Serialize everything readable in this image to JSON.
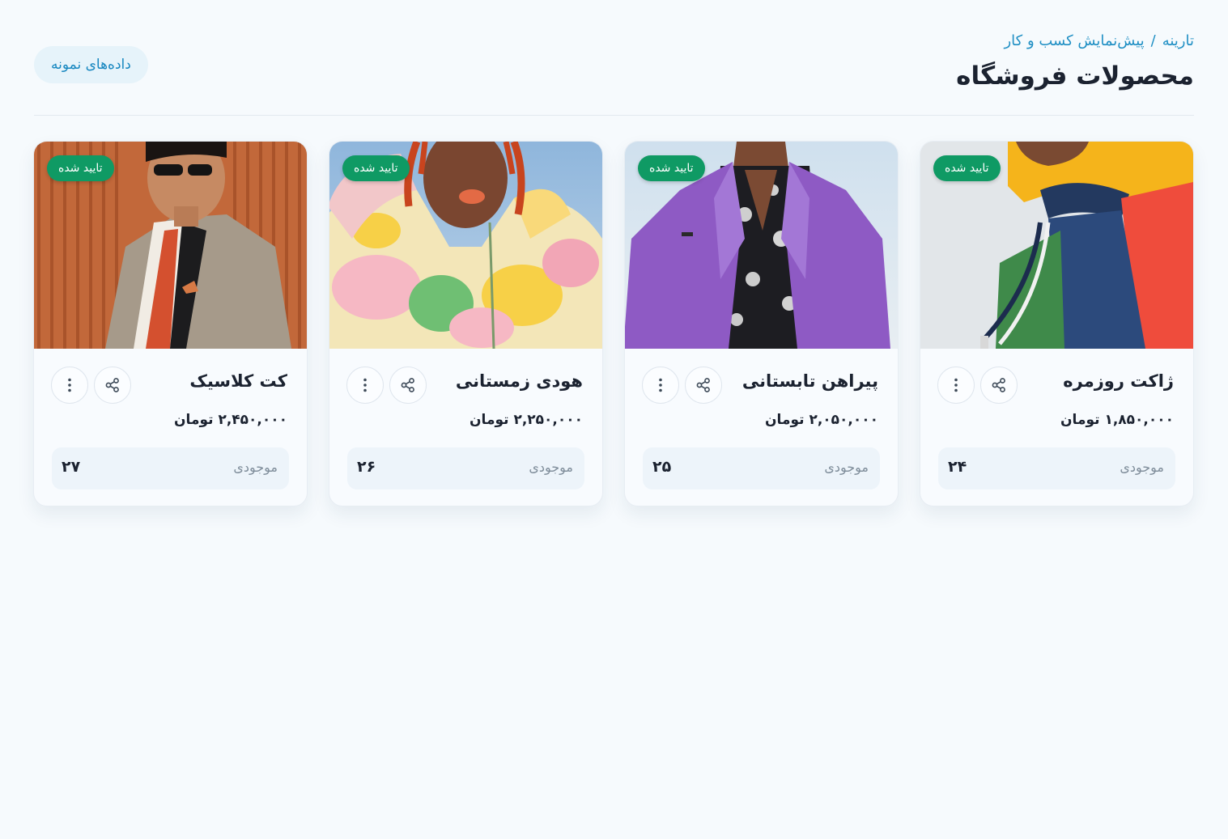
{
  "header": {
    "breadcrumb": {
      "root": "تارینه",
      "separator": "/",
      "current": "پیش‌نمایش کسب و کار"
    },
    "title": "محصولات فروشگاه",
    "sample_button": "داده‌های نمونه"
  },
  "colors": {
    "accent": "#1f8fc4",
    "badge_green": "#0f9a64",
    "background": "#f6fafd"
  },
  "stock_label": "موجودی",
  "products": [
    {
      "name": "ژاکت روزمره",
      "price": "۱,۸۵۰,۰۰۰ تومان",
      "stock": "۲۴",
      "badge": "تایید شده"
    },
    {
      "name": "پیراهن تابستانی",
      "price": "۲,۰۵۰,۰۰۰ تومان",
      "stock": "۲۵",
      "badge": "تایید شده"
    },
    {
      "name": "هودی زمستانی",
      "price": "۲,۲۵۰,۰۰۰ تومان",
      "stock": "۲۶",
      "badge": "تایید شده"
    },
    {
      "name": "کت کلاسیک",
      "price": "۲,۴۵۰,۰۰۰ تومان",
      "stock": "۲۷",
      "badge": "تایید شده"
    }
  ]
}
